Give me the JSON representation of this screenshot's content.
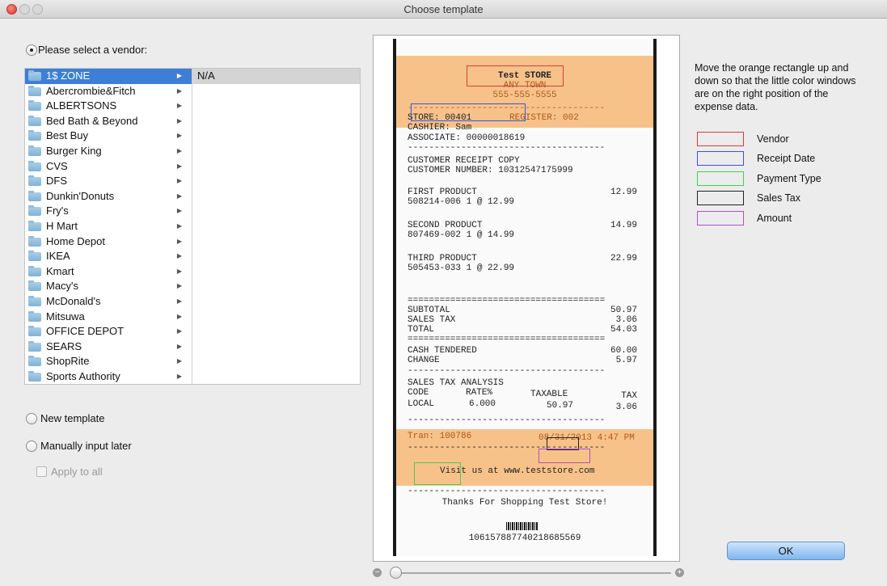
{
  "window": {
    "title": "Choose template"
  },
  "vendor_section": {
    "select_label": "Please select a vendor:",
    "vendors": [
      "1$ ZONE",
      "Abercrombie&Fitch",
      "ALBERTSONS",
      "Bed Bath & Beyond",
      "Best Buy",
      "Burger King",
      "CVS",
      "DFS",
      "Dunkin'Donuts",
      "Fry's",
      "H Mart",
      "Home Depot",
      "IKEA",
      "Kmart",
      "Macy's",
      "McDonald's",
      "Mitsuwa",
      "OFFICE DEPOT",
      "SEARS",
      "ShopRite",
      "Sports Authority"
    ],
    "selected_vendor": "1$ ZONE",
    "detail_value": "N/A"
  },
  "options": {
    "new_template": "New template",
    "manual": "Manually input later",
    "apply_all": "Apply to all"
  },
  "receipt": {
    "store_name": "Test STORE",
    "town": "ANY TOWN",
    "phone": "555-555-5555",
    "store_line": "STORE: 00401",
    "register_line": "REGISTER: 002",
    "cashier": "CASHIER: Sam",
    "associate": "ASSOCIATE: 00000018619",
    "copy": "CUSTOMER RECEIPT COPY",
    "customer_number": "CUSTOMER NUMBER: 10312547175999",
    "items": [
      {
        "name": "FIRST PRODUCT",
        "detail": "508214-006 1 @ 12.99",
        "price": "12.99"
      },
      {
        "name": "SECOND PRODUCT",
        "detail": "807469-002 1 @ 14.99",
        "price": "14.99"
      },
      {
        "name": "THIRD PRODUCT",
        "detail": "505453-033 1 @ 22.99",
        "price": "22.99"
      }
    ],
    "subtotal_label": "SUBTOTAL",
    "subtotal": "50.97",
    "tax_label": "SALES TAX",
    "tax": "3.06",
    "total_label": "TOTAL",
    "total": "54.03",
    "tendered_label": "CASH TENDERED",
    "tendered": "60.00",
    "change_label": "CHANGE",
    "change": "5.97",
    "analysis_title": "SALES TAX ANALYSIS",
    "analysis_headers": [
      "CODE",
      "RATE%",
      "TAXABLE",
      "TAX"
    ],
    "analysis_row": [
      "LOCAL",
      "6.000",
      "50.97",
      "3.06"
    ],
    "tran": "Tran: 100786",
    "datetime": "08/31/2013 4:47 PM",
    "visit": "Visit us at www.teststore.com",
    "thanks": "Thanks For Shopping Test Store!",
    "barcode_number": "106157887740218685569"
  },
  "instructions": "Move the orange rectangle up and down so that the little color windows are on the right position of the expense data.",
  "legend": [
    {
      "label": "Vendor",
      "color": "#e0393a"
    },
    {
      "label": "Receipt Date",
      "color": "#3b52d6"
    },
    {
      "label": "Payment Type",
      "color": "#3ed05a"
    },
    {
      "label": "Sales Tax",
      "color": "#222222"
    },
    {
      "label": "Amount",
      "color": "#b04fc9"
    }
  ],
  "buttons": {
    "ok": "OK"
  },
  "colors": {
    "selection": "#3d7fd7",
    "overlay": "#f5a046"
  }
}
